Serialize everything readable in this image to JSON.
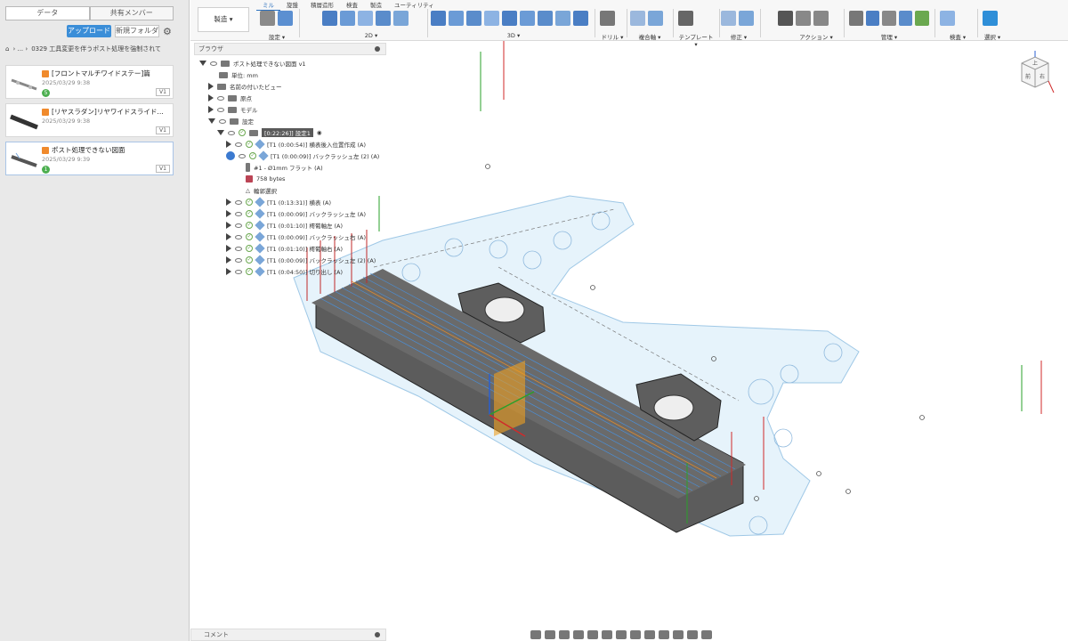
{
  "left_panel": {
    "tabs": [
      "データ",
      "共有メンバー"
    ],
    "upload_label": "アップロード",
    "new_folder_label": "新規フォルダ",
    "breadcrumb": "0329 工具変更を伴うポスト処理を強制されて",
    "items": [
      {
        "title": "[フロントマルチワイドステー]篇",
        "date": "2025/03/29 9:38",
        "version": "V1",
        "badge": "5"
      },
      {
        "title": "[リヤスラダン]リヤワイドスライド…",
        "date": "2025/03/29 9:38",
        "version": "V1",
        "badge": ""
      },
      {
        "title": "ポスト処理できない図面",
        "date": "2025/03/29 9:39",
        "version": "V1",
        "badge": "1"
      }
    ]
  },
  "toolbar": {
    "workspace_label": "製造 ▾",
    "subtabs": [
      "ミル",
      "旋盤",
      "積層造形",
      "検査",
      "製造",
      "ユーティリティ"
    ],
    "groups": [
      "設定 ▾",
      "2D ▾",
      "3D ▾",
      "ドリル ▾",
      "複合軸 ▾",
      "テンプレート ▾",
      "修正 ▾",
      "アクション ▾",
      "管理 ▾",
      "検査 ▾",
      "選択 ▾"
    ]
  },
  "browser": {
    "header": "ブラウザ",
    "root": "ポスト処理できない図面 v1",
    "units": "単位: mm",
    "named_views": "名前の付いたビュー",
    "origin": "原点",
    "models": "モデル",
    "setups": "設定",
    "setup1": "[0:22:26]] 設定1",
    "ops": [
      "[T1 (0:00:54)] 横表後入位置作成 (A)",
      "[T1 (0:00:09)] バックラッシュ左 (2) (A)"
    ],
    "tool": "#1 - Ø1mm フラット (A)",
    "bytes": "758 bytes",
    "contour": "輪郭選択",
    "ops2": [
      "[T1 (0:13:31)] 横表 (A)",
      "[T1 (0:00:09)] バックラッシュ左 (A)",
      "[T1 (0:01:10)] 樗葡軸左 (A)",
      "[T1 (0:00:09)] バックラッシュ右 (A)",
      "[T1 (0:01:10)] 樗葡軸右 (A)",
      "[T1 (0:00:09)] バックラッシュ左 (2) (A)",
      "[T1 (0:04:50)] 切り出し (A)"
    ]
  },
  "comment_label": "コメント",
  "viewcube": {
    "faces": [
      "上",
      "前",
      "右"
    ]
  }
}
